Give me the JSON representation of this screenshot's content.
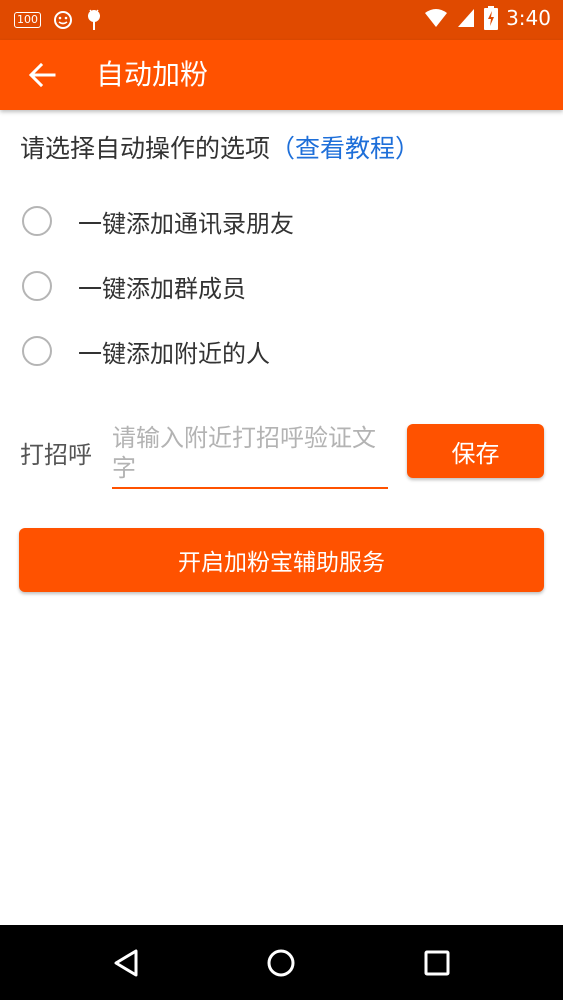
{
  "status_bar": {
    "badge": "100",
    "time": "3:40",
    "icons": [
      "battery-badge-icon",
      "smiley-icon",
      "android-icon",
      "wifi-icon",
      "signal-icon",
      "battery-charging-icon"
    ]
  },
  "app_bar": {
    "back_icon": "arrow-back-icon",
    "title": "自动加粉"
  },
  "prompt": {
    "text": "请选择自动操作的选项",
    "link": "（查看教程）"
  },
  "options": [
    {
      "label": "一键添加通讯录朋友",
      "selected": false
    },
    {
      "label": "一键添加群成员",
      "selected": false
    },
    {
      "label": "一键添加附近的人",
      "selected": false
    }
  ],
  "greeting": {
    "label": "打招呼",
    "placeholder": "请输入附近打招呼验证文字",
    "value": "",
    "save_label": "保存"
  },
  "service_button": "开启加粉宝辅助服务",
  "colors": {
    "status_bar": "#e04a00",
    "accent": "#ff5200",
    "link": "#1e6fd9"
  },
  "nav_bar": {
    "icons": [
      "back-triangle-icon",
      "home-circle-icon",
      "recents-square-icon"
    ]
  }
}
